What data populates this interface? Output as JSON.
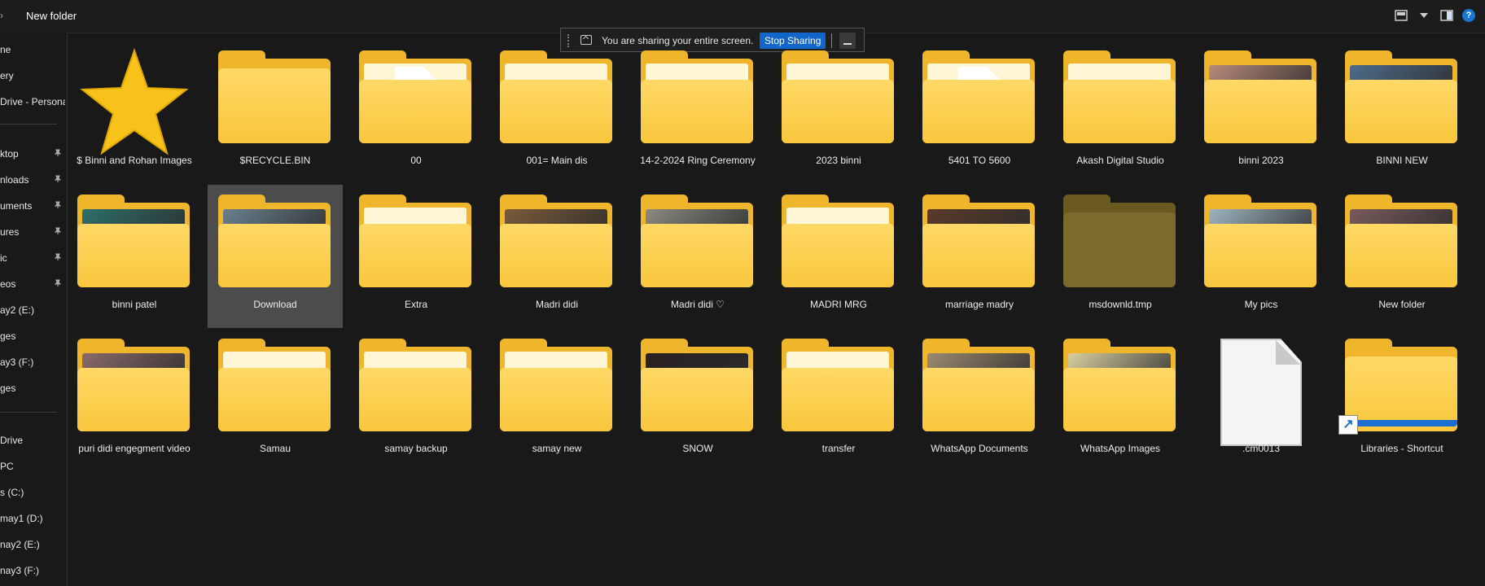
{
  "window": {
    "title": "New folder",
    "back_glyph": "›"
  },
  "toolbar": {
    "view_icon": "view-icon",
    "pane_icon": "details-pane-icon",
    "help_label": "?"
  },
  "share_bar": {
    "message": "You are sharing your entire screen.",
    "stop_label": "Stop Sharing"
  },
  "sidebar": {
    "items": [
      {
        "label": "ne",
        "pinned": false
      },
      {
        "label": "ery",
        "pinned": false
      },
      {
        "label": "Drive - Persona",
        "pinned": false
      },
      {
        "label": "ktop",
        "pinned": true
      },
      {
        "label": "nloads",
        "pinned": true
      },
      {
        "label": "uments",
        "pinned": true
      },
      {
        "label": "ures",
        "pinned": true
      },
      {
        "label": "ic",
        "pinned": true
      },
      {
        "label": "eos",
        "pinned": true
      },
      {
        "label": "ay2 (E:)",
        "pinned": false
      },
      {
        "label": "ges",
        "pinned": false
      },
      {
        "label": "ay3 (F:)",
        "pinned": false
      },
      {
        "label": "ges",
        "pinned": false
      },
      {
        "label": "Drive",
        "pinned": false
      },
      {
        "label": "PC",
        "pinned": false
      },
      {
        "label": "s (C:)",
        "pinned": false
      },
      {
        "label": "may1 (D:)",
        "pinned": false
      },
      {
        "label": "nay2 (E:)",
        "pinned": false
      },
      {
        "label": "nay3 (F:)",
        "pinned": false
      }
    ]
  },
  "items": [
    {
      "name": "$ Binni and Rohan Images",
      "type": "star"
    },
    {
      "name": "$RECYCLE.BIN",
      "type": "folder-empty"
    },
    {
      "name": "00",
      "type": "folder-doc"
    },
    {
      "name": "001= Main dis",
      "type": "folder-paper"
    },
    {
      "name": "14-2-2024 Ring Ceremony",
      "type": "folder-paper"
    },
    {
      "name": "2023 binni",
      "type": "folder-paper"
    },
    {
      "name": "5401 TO 5600",
      "type": "folder-doc"
    },
    {
      "name": "Akash Digital Studio",
      "type": "folder-paper"
    },
    {
      "name": "binni 2023",
      "type": "folder-photo",
      "tint": "#b88a7a"
    },
    {
      "name": "BINNI NEW",
      "type": "folder-photo",
      "tint": "#4d6b8a"
    },
    {
      "name": "binni patel",
      "type": "folder-photo",
      "tint": "#2e6f6a"
    },
    {
      "name": "Download",
      "type": "folder-photo",
      "tint": "#6a7f8e",
      "selected": true
    },
    {
      "name": "Extra",
      "type": "folder-paper"
    },
    {
      "name": "Madri didi",
      "type": "folder-photo",
      "tint": "#7a5a3a"
    },
    {
      "name": "Madri didi ♡",
      "type": "folder-photo",
      "tint": "#8a8a80"
    },
    {
      "name": "MADRI MRG",
      "type": "folder-paper"
    },
    {
      "name": "marriage madry",
      "type": "folder-photo",
      "tint": "#5a3a2a"
    },
    {
      "name": "msdownld.tmp",
      "type": "folder-dim"
    },
    {
      "name": "My pics",
      "type": "folder-photo",
      "tint": "#9fb4c0"
    },
    {
      "name": "New folder",
      "type": "folder-photo",
      "tint": "#7a5a5a"
    },
    {
      "name": "puri didi engegment video",
      "type": "folder-photo",
      "tint": "#8a6a6a"
    },
    {
      "name": "Samau",
      "type": "folder-paper"
    },
    {
      "name": "samay backup",
      "type": "folder-paper"
    },
    {
      "name": "samay new",
      "type": "folder-paper"
    },
    {
      "name": "SNOW",
      "type": "folder-photo",
      "tint": "#2a2020"
    },
    {
      "name": "transfer",
      "type": "folder-paper"
    },
    {
      "name": "WhatsApp Documents",
      "type": "folder-photo",
      "tint": "#9a8a70"
    },
    {
      "name": "WhatsApp Images",
      "type": "folder-photo",
      "tint": "#d8d0a0"
    },
    {
      "name": ".cm0013",
      "type": "file"
    },
    {
      "name": "Libraries - Shortcut",
      "type": "library-shortcut"
    }
  ]
}
